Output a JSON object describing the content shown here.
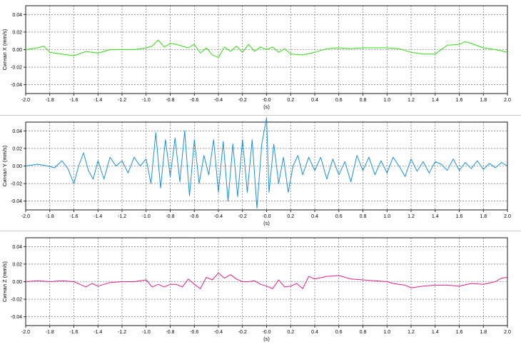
{
  "chart_data": [
    {
      "type": "line",
      "id": "x",
      "xlabel": "(s)",
      "ylabel": "Сигнал X (mm/s)",
      "xlim": [
        -2.0,
        2.0
      ],
      "ylim": [
        -0.05,
        0.05
      ],
      "xticks": [
        "-2.0",
        "-1.8",
        "-1.6",
        "-1.4",
        "-1.2",
        "-1.0",
        "-0.8",
        "-0.6",
        "-0.4",
        "-0.2",
        "-0.0",
        "0.2",
        "0.4",
        "0.6",
        "0.8",
        "1.0",
        "1.2",
        "1.4",
        "1.6",
        "1.8",
        "2.0"
      ],
      "yticks": [
        "0.04",
        "0.02",
        "0.00",
        "-0.02",
        "-0.04"
      ],
      "grid": true,
      "color": "#33dd11",
      "series": [
        {
          "x": [
            -2.0,
            -1.9,
            -1.85,
            -1.8,
            -1.7,
            -1.6,
            -1.5,
            -1.4,
            -1.3,
            -1.2,
            -1.1,
            -1.0,
            -0.95,
            -0.9,
            -0.85,
            -0.8,
            -0.75,
            -0.7,
            -0.65,
            -0.6,
            -0.55,
            -0.5,
            -0.45,
            -0.4,
            -0.35,
            -0.3,
            -0.25,
            -0.2,
            -0.15,
            -0.1,
            -0.05,
            0.0,
            0.05,
            0.1,
            0.15,
            0.2,
            0.3,
            0.4,
            0.5,
            0.6,
            0.7,
            0.8,
            0.9,
            1.0,
            1.1,
            1.2,
            1.3,
            1.4,
            1.5,
            1.6,
            1.65,
            1.7,
            1.8,
            1.9,
            2.0
          ],
          "values": [
            0.0,
            0.002,
            0.004,
            -0.003,
            -0.005,
            -0.007,
            -0.002,
            -0.004,
            0.0,
            0.0,
            0.0,
            0.002,
            0.004,
            0.011,
            0.003,
            0.007,
            0.006,
            0.004,
            0.002,
            0.006,
            -0.004,
            0.002,
            -0.006,
            -0.009,
            0.003,
            -0.002,
            0.004,
            -0.003,
            0.006,
            -0.002,
            0.003,
            0.0,
            0.003,
            -0.003,
            0.001,
            -0.005,
            -0.006,
            -0.003,
            0.001,
            0.002,
            0.001,
            0.002,
            0.002,
            0.002,
            0.001,
            -0.003,
            -0.005,
            -0.005,
            0.005,
            0.006,
            0.009,
            0.007,
            0.002,
            0.0,
            -0.003
          ]
        }
      ]
    },
    {
      "type": "line",
      "id": "y",
      "xlabel": "(s)",
      "ylabel": "Сигнал Y (mm/s)",
      "xlim": [
        -2.0,
        2.0
      ],
      "ylim": [
        -0.05,
        0.05
      ],
      "xticks": [
        "-2.0",
        "-1.8",
        "-1.6",
        "-1.4",
        "-1.2",
        "-1.0",
        "-0.8",
        "-0.6",
        "-0.4",
        "-0.2",
        "-0.0",
        "0.2",
        "0.4",
        "0.6",
        "0.8",
        "1.0",
        "1.2",
        "1.4",
        "1.6",
        "1.8",
        "2.0"
      ],
      "yticks": [
        "0.04",
        "0.02",
        "0.00",
        "-0.02",
        "-0.04"
      ],
      "grid": true,
      "color": "#1a90e0",
      "series": [
        {
          "x": [
            -2.0,
            -1.9,
            -1.82,
            -1.76,
            -1.7,
            -1.65,
            -1.6,
            -1.56,
            -1.52,
            -1.48,
            -1.44,
            -1.4,
            -1.35,
            -1.3,
            -1.25,
            -1.2,
            -1.15,
            -1.1,
            -1.05,
            -1.0,
            -0.96,
            -0.92,
            -0.88,
            -0.84,
            -0.8,
            -0.76,
            -0.72,
            -0.68,
            -0.64,
            -0.6,
            -0.56,
            -0.52,
            -0.48,
            -0.44,
            -0.4,
            -0.36,
            -0.32,
            -0.28,
            -0.24,
            -0.2,
            -0.16,
            -0.12,
            -0.08,
            -0.04,
            0.0,
            0.02,
            0.06,
            0.1,
            0.14,
            0.18,
            0.22,
            0.26,
            0.3,
            0.35,
            0.4,
            0.45,
            0.5,
            0.55,
            0.6,
            0.65,
            0.7,
            0.75,
            0.8,
            0.85,
            0.9,
            0.95,
            1.0,
            1.05,
            1.1,
            1.15,
            1.2,
            1.25,
            1.3,
            1.35,
            1.4,
            1.45,
            1.5,
            1.55,
            1.6,
            1.65,
            1.7,
            1.75,
            1.8,
            1.85,
            1.9,
            1.95,
            2.0
          ],
          "values": [
            0.0,
            0.002,
            0.0,
            -0.002,
            0.006,
            -0.003,
            -0.02,
            0.0,
            0.015,
            -0.005,
            -0.015,
            0.006,
            -0.015,
            0.01,
            0.0,
            0.006,
            -0.008,
            0.01,
            0.0,
            0.008,
            -0.02,
            0.038,
            -0.025,
            0.03,
            -0.012,
            0.032,
            -0.018,
            0.04,
            -0.034,
            0.03,
            -0.02,
            0.012,
            -0.01,
            0.03,
            -0.03,
            0.028,
            -0.04,
            0.025,
            -0.035,
            0.03,
            -0.03,
            0.03,
            -0.048,
            0.025,
            0.055,
            -0.03,
            0.025,
            -0.02,
            0.01,
            -0.03,
            0.0,
            0.012,
            -0.01,
            0.01,
            -0.005,
            0.01,
            -0.015,
            0.008,
            -0.01,
            0.005,
            -0.018,
            0.012,
            -0.005,
            0.01,
            -0.01,
            0.006,
            -0.008,
            0.01,
            0.0,
            -0.012,
            0.008,
            -0.006,
            0.005,
            -0.008,
            0.005,
            0.002,
            -0.005,
            0.008,
            -0.005,
            0.004,
            -0.003,
            0.006,
            -0.004,
            0.003,
            -0.002,
            0.004,
            0.0
          ]
        }
      ]
    },
    {
      "type": "line",
      "id": "z",
      "xlabel": "(s)",
      "ylabel": "Сигнал Z (mm/s)",
      "xlim": [
        -2.0,
        2.0
      ],
      "ylim": [
        -0.05,
        0.05
      ],
      "xticks": [
        "-2.0",
        "-1.8",
        "-1.6",
        "-1.4",
        "-1.2",
        "-1.0",
        "-0.8",
        "-0.6",
        "-0.4",
        "-0.2",
        "-0.0",
        "0.2",
        "0.4",
        "0.6",
        "0.8",
        "1.0",
        "1.2",
        "1.4",
        "1.6",
        "1.8",
        "2.0"
      ],
      "yticks": [
        "0.04",
        "0.02",
        "0.00",
        "-0.02",
        "-0.04"
      ],
      "grid": true,
      "color": "#e0208a",
      "series": [
        {
          "x": [
            -2.0,
            -1.9,
            -1.8,
            -1.7,
            -1.6,
            -1.55,
            -1.5,
            -1.45,
            -1.4,
            -1.3,
            -1.2,
            -1.1,
            -1.0,
            -0.95,
            -0.9,
            -0.85,
            -0.8,
            -0.75,
            -0.7,
            -0.65,
            -0.6,
            -0.55,
            -0.5,
            -0.45,
            -0.4,
            -0.35,
            -0.3,
            -0.25,
            -0.2,
            -0.15,
            -0.1,
            -0.05,
            0.0,
            0.05,
            0.1,
            0.15,
            0.2,
            0.25,
            0.3,
            0.35,
            0.4,
            0.5,
            0.6,
            0.7,
            0.8,
            0.9,
            1.0,
            1.05,
            1.1,
            1.15,
            1.2,
            1.3,
            1.4,
            1.5,
            1.6,
            1.7,
            1.8,
            1.9,
            1.95,
            2.0
          ],
          "values": [
            0.0,
            0.001,
            0.0,
            0.001,
            0.0,
            -0.003,
            -0.006,
            -0.002,
            -0.005,
            -0.001,
            0.0,
            0.0,
            0.002,
            -0.006,
            -0.003,
            -0.006,
            -0.003,
            -0.003,
            -0.006,
            0.003,
            -0.003,
            -0.008,
            0.005,
            0.002,
            0.01,
            0.004,
            0.008,
            0.003,
            0.0,
            0.0,
            0.001,
            -0.003,
            -0.005,
            -0.008,
            0.002,
            -0.006,
            -0.005,
            -0.002,
            -0.008,
            0.006,
            0.003,
            0.006,
            0.007,
            0.003,
            0.002,
            0.001,
            0.0,
            -0.002,
            -0.003,
            -0.004,
            -0.007,
            -0.005,
            -0.004,
            -0.004,
            -0.005,
            -0.002,
            -0.003,
            0.0,
            0.004,
            0.005
          ]
        }
      ]
    }
  ]
}
